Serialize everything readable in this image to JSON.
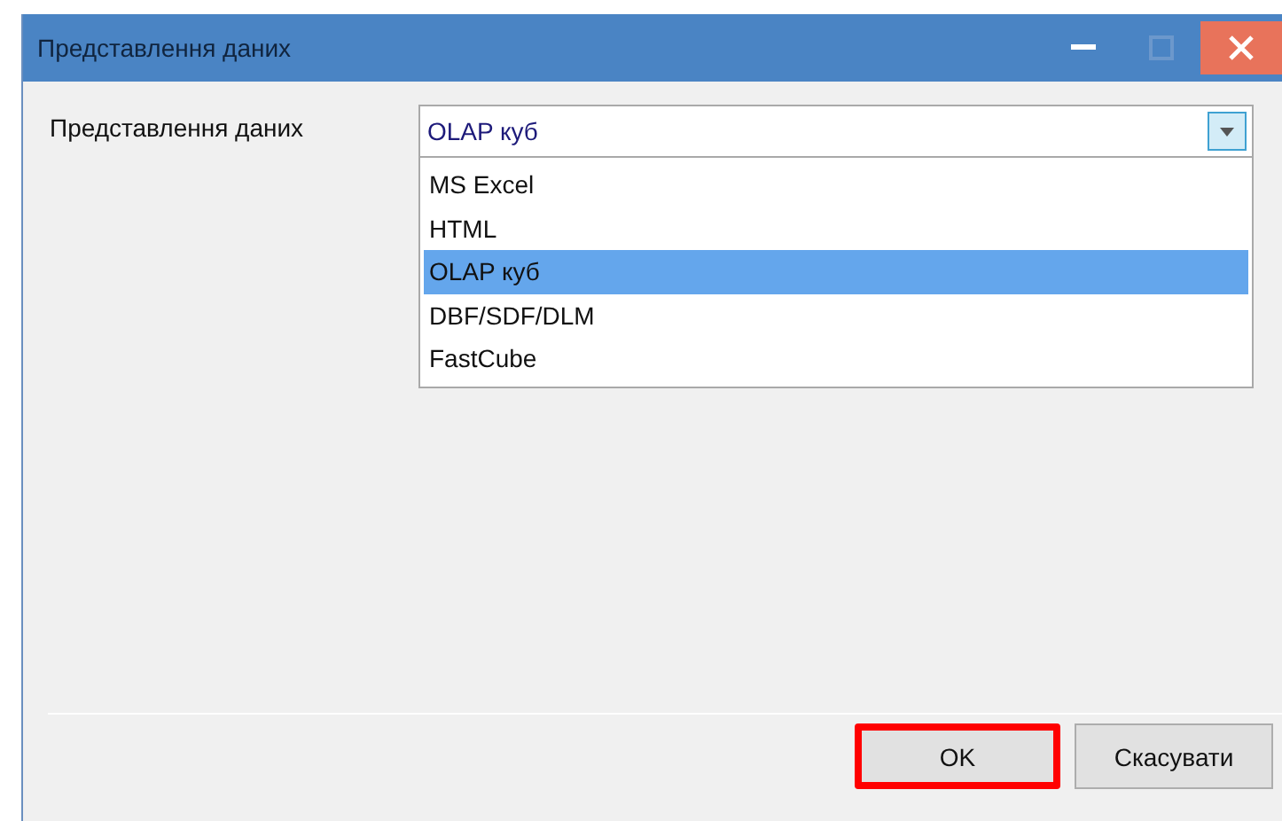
{
  "window": {
    "title": "Представлення даних"
  },
  "field": {
    "label": "Представлення даних",
    "value": "OLAP куб",
    "expanded": true,
    "options": [
      {
        "label": "MS Excel",
        "selected": false
      },
      {
        "label": "HTML",
        "selected": false
      },
      {
        "label": "OLAP куб",
        "selected": true
      },
      {
        "label": "DBF/SDF/DLM",
        "selected": false
      },
      {
        "label": "FastCube",
        "selected": false
      }
    ]
  },
  "buttons": [
    {
      "label": "OK",
      "highlighted": true
    },
    {
      "label": "Скасувати",
      "highlighted": false
    }
  ]
}
